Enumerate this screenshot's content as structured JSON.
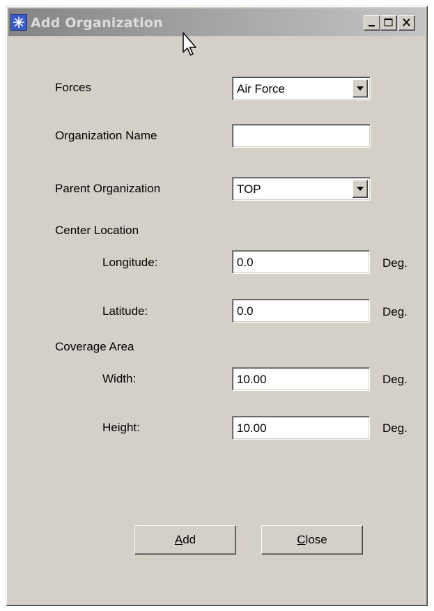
{
  "window": {
    "title": "Add Organization",
    "controls": {
      "minimize": "minimize-icon",
      "maximize": "maximize-icon",
      "close": "close-icon"
    }
  },
  "form": {
    "forces": {
      "label": "Forces",
      "value": "Air Force"
    },
    "org_name": {
      "label": "Organization Name",
      "value": ""
    },
    "parent_org": {
      "label": "Parent Organization",
      "value": "TOP"
    },
    "center_location": {
      "heading": "Center Location",
      "longitude": {
        "label": "Longitude:",
        "value": "0.0",
        "unit": "Deg."
      },
      "latitude": {
        "label": "Latitude:",
        "value": "0.0",
        "unit": "Deg."
      }
    },
    "coverage_area": {
      "heading": "Coverage Area",
      "width": {
        "label": "Width:",
        "value": "10.00",
        "unit": "Deg."
      },
      "height": {
        "label": "Height:",
        "value": "10.00",
        "unit": "Deg."
      }
    }
  },
  "buttons": {
    "add": {
      "mnemonic": "A",
      "rest": "dd"
    },
    "close": {
      "mnemonic": "C",
      "rest": "lose"
    }
  },
  "colors": {
    "dialog_bg": "#d4d0c8",
    "title_gradient_start": "#848484",
    "title_gradient_end": "#c4c4c4",
    "app_icon": "#3a5ac8"
  }
}
